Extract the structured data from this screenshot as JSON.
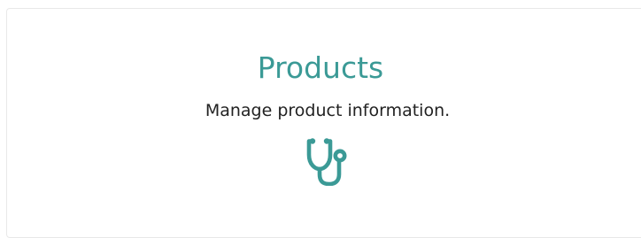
{
  "card": {
    "title": "Products",
    "description": "Manage product information.",
    "icon": "stethoscope-icon",
    "accent_color": "#3b9a96"
  }
}
